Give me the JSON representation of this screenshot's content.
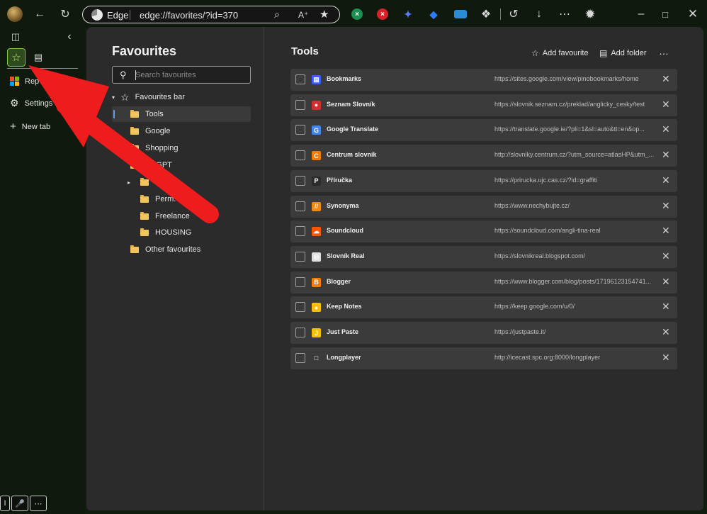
{
  "browser": {
    "brand": "Edge",
    "url": "edge://favorites/?id=370",
    "icons": [
      "profile-avatar",
      "back-icon",
      "refresh-icon",
      "zoom-icon",
      "read-aloud-icon",
      "favorite-star-icon"
    ],
    "extensions": [
      "excel-ext-icon",
      "block-ext-icon",
      "pin-ext-icon",
      "gem-ext-icon",
      "card-ext-icon",
      "puzzle-icon",
      "history-icon",
      "download-icon",
      "more-icon",
      "copilot-icon"
    ],
    "window_controls": [
      "minimize-icon",
      "maximize-icon",
      "close-icon"
    ]
  },
  "vertical_tabs": {
    "items": [
      {
        "label": "Rep",
        "icon": "microsoft-icon"
      },
      {
        "label": "Settings",
        "icon": "gear-icon"
      },
      {
        "label": "New tab",
        "icon": "plus-icon"
      }
    ]
  },
  "favourites": {
    "title": "Favourites",
    "search_placeholder": "Search favourites",
    "tree": [
      {
        "label": "Favourites bar",
        "level": 0
      },
      {
        "label": "Tools",
        "level": 1,
        "selected": true
      },
      {
        "label": "Google",
        "level": 1
      },
      {
        "label": "Shopping",
        "level": 1
      },
      {
        "label": "hatGPT",
        "level": 1
      },
      {
        "label": "Fol",
        "level": 1,
        "collapsed": true
      },
      {
        "label": "Perm. BM",
        "level": 1
      },
      {
        "label": "Freelance",
        "level": 1
      },
      {
        "label": "HOUSING",
        "level": 1
      },
      {
        "label": "Other favourites",
        "level": 0
      }
    ]
  },
  "list": {
    "title": "Tools",
    "add_favourite": "Add favourite",
    "add_folder": "Add folder",
    "more": "…",
    "items": [
      {
        "name": "Bookmarks",
        "url": "https://sites.google.com/view/pinobookmarks/home",
        "favicon_color": "#3d5afe",
        "glyph": "▤"
      },
      {
        "name": "Seznam Slovník",
        "url": "https://slovnik.seznam.cz/preklad/anglicky_cesky/test",
        "favicon_color": "#d32f2f",
        "glyph": "●"
      },
      {
        "name": "Google Translate",
        "url": "https://translate.google.ie/?pli=1&sl=auto&tl=en&op...",
        "favicon_color": "#4285f4",
        "glyph": "G"
      },
      {
        "name": "Centrum slovník",
        "url": "http://slovniky.centrum.cz/?utm_source=atlasHP&utm_...",
        "favicon_color": "#f57c00",
        "glyph": "C"
      },
      {
        "name": "Příručka",
        "url": "https://prirucka.ujc.cas.cz/?id=graffiti",
        "favicon_color": "#2b2b2b",
        "glyph": "P"
      },
      {
        "name": "Synonyma",
        "url": "https://www.nechybujte.cz/",
        "favicon_color": "#ef8a17",
        "glyph": "//"
      },
      {
        "name": "Soundcloud",
        "url": "https://soundcloud.com/angli-tina-real",
        "favicon_color": "#ff5500",
        "glyph": "☁"
      },
      {
        "name": "Slovník Real",
        "url": "https://slovnikreal.blogspot.com/",
        "favicon_color": "#e0e0e0",
        "glyph": "◎"
      },
      {
        "name": "Blogger",
        "url": "https://www.blogger.com/blog/posts/17196123154741...",
        "favicon_color": "#f57d00",
        "glyph": "B"
      },
      {
        "name": "Keep Notes",
        "url": "https://keep.google.com/u/0/",
        "favicon_color": "#fbbc04",
        "glyph": "●"
      },
      {
        "name": "Just Paste",
        "url": "https://justpaste.it/",
        "favicon_color": "#f2c200",
        "glyph": "J"
      },
      {
        "name": "Longplayer",
        "url": "http://icecast.spc.org:8000/longplayer",
        "favicon_color": "#3b3b3b",
        "glyph": "□"
      }
    ]
  },
  "annotation": {
    "arrow_color": "#ee1c1c"
  }
}
